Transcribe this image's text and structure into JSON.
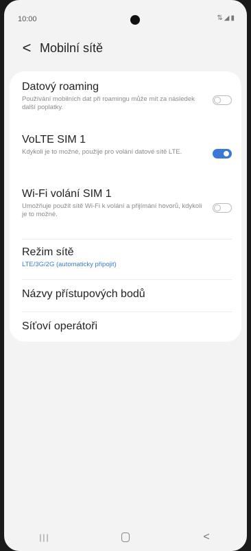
{
  "status_bar": {
    "time": "10:00",
    "icons": "⇅◢▮"
  },
  "header": {
    "back_glyph": "<",
    "title": "Mobilní sítě"
  },
  "settings": [
    {
      "title": "Datový roaming",
      "subtitle": "Používání mobilních dat při roamingu může mít za následek další poplatky.",
      "toggle": "off"
    },
    {
      "title": "VoLTE SIM 1",
      "subtitle": "Kdykoli je to možné, použije pro volání datové sítě LTE.",
      "toggle": "on"
    },
    {
      "title": "Wi-Fi volání SIM 1",
      "subtitle": "Umožňuje použít sítě Wi-Fi k volání a přijímání hovorů, kdykoli je to možné.",
      "toggle": "off"
    },
    {
      "title": "Režim sítě",
      "subtitle": "LTE/3G/2G (automaticky připojit)"
    },
    {
      "title": "Názvy přístupových bodů"
    },
    {
      "title": "Síťoví operátoři"
    }
  ],
  "navbar": {
    "recent_glyph": "|||",
    "back_glyph": "<"
  },
  "colors": {
    "accent": "#3a7ad6",
    "background": "#f3f3f3",
    "card": "#ffffff"
  }
}
